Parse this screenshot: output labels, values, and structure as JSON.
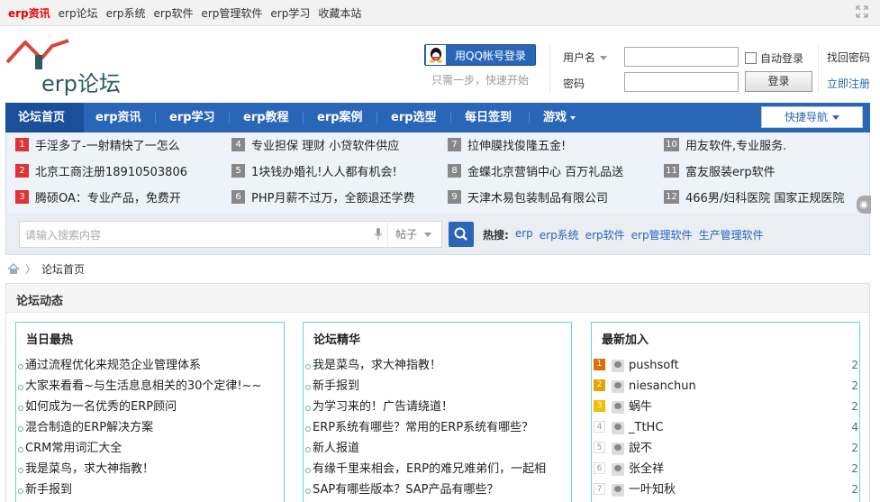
{
  "topbar": {
    "links": [
      "erp资讯",
      "erp论坛",
      "erp系统",
      "erp软件",
      "erp管理软件",
      "erp学习",
      "收藏本站"
    ]
  },
  "logo": {
    "text": "erp论坛"
  },
  "login": {
    "qq_button": "用QQ帐号登录",
    "qq_tip": "只需一步，快速开始",
    "username_label": "用户名",
    "password_label": "密码",
    "auto_login": "自动登录",
    "login_button": "登录",
    "find_password": "找回密码",
    "register": "立即注册"
  },
  "nav": {
    "items": [
      "论坛首页",
      "erp资讯",
      "erp学习",
      "erp教程",
      "erp案例",
      "erp选型",
      "每日签到",
      "游戏"
    ],
    "quick_nav": "快捷导航"
  },
  "ads": [
    {
      "n": "1",
      "text": "手淫多了-一射精快了一怎么"
    },
    {
      "n": "2",
      "text": "北京工商注册18910503806"
    },
    {
      "n": "3",
      "text": "腾硕OA：专业产品，免费开"
    },
    {
      "n": "4",
      "text": "专业担保 理财 小贷软件供应"
    },
    {
      "n": "5",
      "text": "1块钱办婚礼!人人都有机会!"
    },
    {
      "n": "6",
      "text": "PHP月薪不过万，全额退还学费"
    },
    {
      "n": "7",
      "text": "拉伸膜找俊隆五金!"
    },
    {
      "n": "8",
      "text": "金蝶北京营销中心 百万礼品送"
    },
    {
      "n": "9",
      "text": "天津木易包装制品有限公司"
    },
    {
      "n": "10",
      "text": "用友软件,专业服务."
    },
    {
      "n": "11",
      "text": "富友服装erp软件"
    },
    {
      "n": "12",
      "text": "466男/妇科医院 国家正规医院"
    }
  ],
  "search": {
    "placeholder": "请输入搜索内容",
    "type": "帖子",
    "hot_label": "热搜:",
    "hot_keywords": [
      "erp",
      "erp系统",
      "erp软件",
      "erp管理软件",
      "生产管理软件"
    ]
  },
  "breadcrumb": {
    "current": "论坛首页"
  },
  "section": {
    "title": "论坛动态",
    "today": {
      "title": "当日最热",
      "items": [
        "通过流程优化来规范企业管理体系",
        "大家来看看~与生活息息相关的30个定律!~~",
        "如何成为一名优秀的ERP顾问",
        "混合制造的ERP解决方案",
        "CRM常用词汇大全",
        "我是菜鸟，求大神指教！",
        "新手报到"
      ]
    },
    "digest": {
      "title": "论坛精华",
      "items": [
        "我是菜鸟，求大神指教！",
        "新手报到",
        "为学习来的！广告请绕道！",
        "ERP系统有哪些？常用的ERP系统有哪些？",
        "新人报道",
        "有缘千里来相会，ERP的难兄难弟们，一起相",
        "SAP有哪些版本？SAP产品有哪些？"
      ]
    },
    "members": {
      "title": "最新加入",
      "items": [
        {
          "rank": "1",
          "name": "pushsoft",
          "count": "2"
        },
        {
          "rank": "2",
          "name": "niesanchun",
          "count": "2"
        },
        {
          "rank": "3",
          "name": "蜗牛",
          "count": "2"
        },
        {
          "rank": "4",
          "name": "_TtHC",
          "count": "4"
        },
        {
          "rank": "5",
          "name": "說不",
          "count": "2"
        },
        {
          "rank": "6",
          "name": "张全祥",
          "count": "2"
        },
        {
          "rank": "7",
          "name": "一叶知秋",
          "count": "2"
        }
      ]
    }
  }
}
